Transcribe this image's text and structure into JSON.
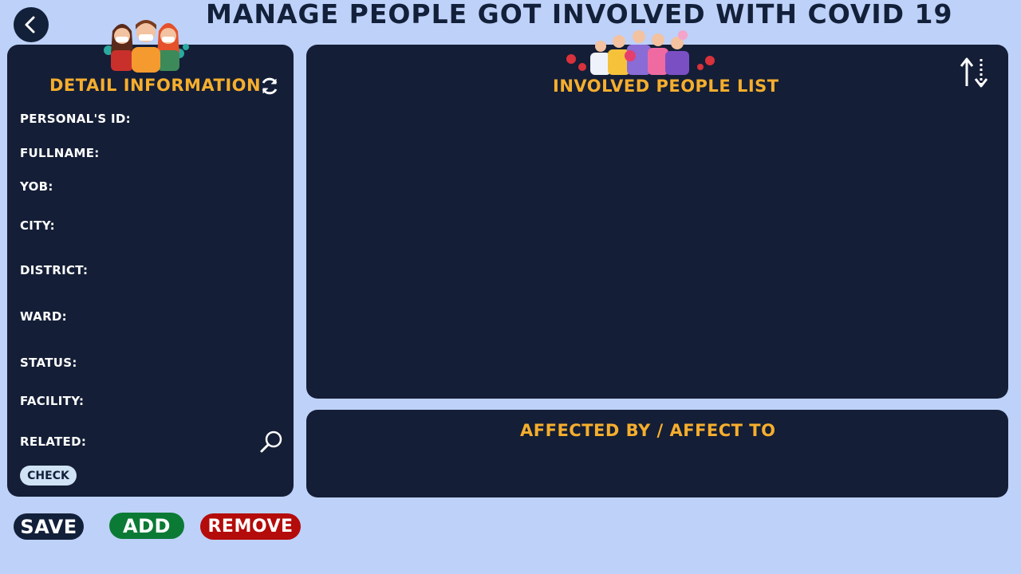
{
  "header": {
    "title": "MANAGE PEOPLE GOT INVOLVED WITH COVID 19",
    "back_icon": "chevron-left-icon"
  },
  "detail_panel": {
    "heading": "DETAIL INFORMATION",
    "refresh_icon": "refresh-icon",
    "fields": {
      "personal_id": "PERSONAL'S ID:",
      "fullname": "FULLNAME:",
      "yob": "YOB:",
      "city": "CITY:",
      "district": "DISTRICT:",
      "ward": "WARD:",
      "status": "STATUS:",
      "facility": "FACILITY:",
      "related": "RELATED:"
    },
    "search_icon": "magnifier-icon",
    "check_label": "CHECK"
  },
  "list_panel": {
    "heading": "INVOLVED PEOPLE LIST",
    "sort_icon": "sort-arrows-icon"
  },
  "affect_panel": {
    "heading": "AFFECTED BY / AFFECT TO"
  },
  "actions": {
    "save_label": "SAVE",
    "add_label": "ADD",
    "remove_label": "REMOVE"
  },
  "colors": {
    "background": "#bed1f8",
    "panel": "#141e36",
    "heading_accent": "#f6ae2d",
    "add": "#0b7a35",
    "remove": "#b40b0b"
  }
}
